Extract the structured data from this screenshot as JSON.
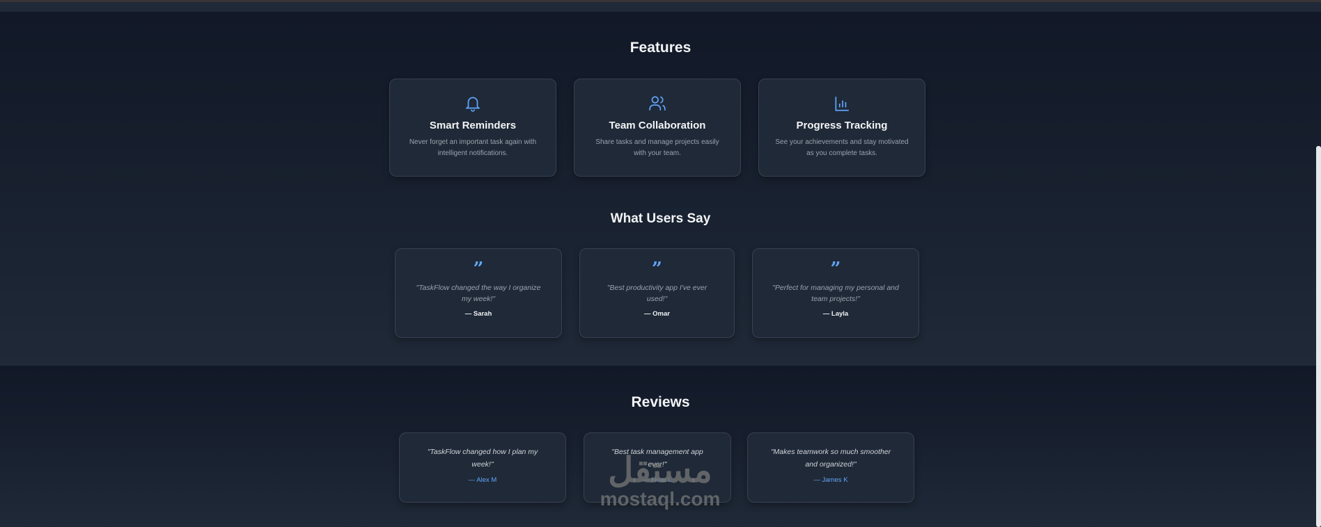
{
  "features": {
    "title": "Features",
    "items": [
      {
        "icon": "bell-icon",
        "title": "Smart Reminders",
        "desc": "Never forget an important task again with intelligent notifications."
      },
      {
        "icon": "users-icon",
        "title": "Team Collaboration",
        "desc": "Share tasks and manage projects easily with your team."
      },
      {
        "icon": "bar-chart-icon",
        "title": "Progress Tracking",
        "desc": "See your achievements and stay motivated as you complete tasks."
      }
    ]
  },
  "testimonials": {
    "title": "What Users Say",
    "items": [
      {
        "quote": "\"TaskFlow changed the way I organize my week!\"",
        "author": "— Sarah"
      },
      {
        "quote": "\"Best productivity app I've ever used!\"",
        "author": "— Omar"
      },
      {
        "quote": "\"Perfect for managing my personal and team projects!\"",
        "author": "— Layla"
      }
    ]
  },
  "reviews": {
    "title": "Reviews",
    "items": [
      {
        "quote": "\"TaskFlow changed how I plan my week!\"",
        "author": "— Alex M"
      },
      {
        "quote": "\"Best task management app ever!\"",
        "author": "— Nora L"
      },
      {
        "quote": "\"Makes teamwork so much smoother and organized!\"",
        "author": "— James K"
      }
    ]
  },
  "watermark": {
    "arabic": "مستقل",
    "latin": "mostaql.com"
  },
  "colors": {
    "accent": "#60a5fa",
    "bg": "#111827",
    "card": "#1f2937"
  }
}
